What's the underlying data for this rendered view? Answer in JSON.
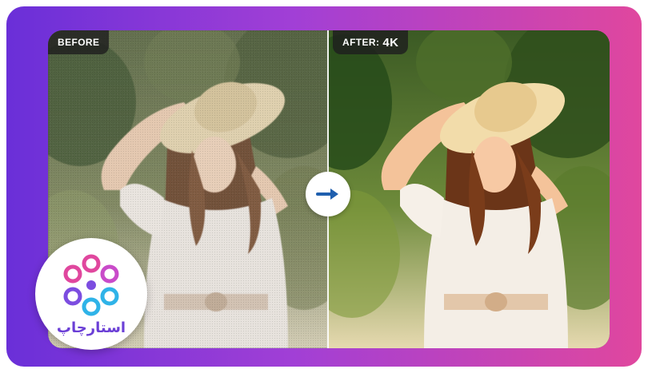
{
  "labels": {
    "before": "BEFORE",
    "after_prefix": "AFTER:",
    "after_strong": "4K"
  },
  "brand": {
    "name": "استارچاپ",
    "logo_colors": [
      "#e0479e",
      "#7c4de0",
      "#2fb3e8"
    ]
  },
  "colors": {
    "gradient_start": "#6a2fd8",
    "gradient_end": "#e0479e",
    "arrow": "#1f5fae"
  },
  "icons": {
    "arrow": "arrow-right-icon",
    "logo": "flower-logo-icon"
  }
}
